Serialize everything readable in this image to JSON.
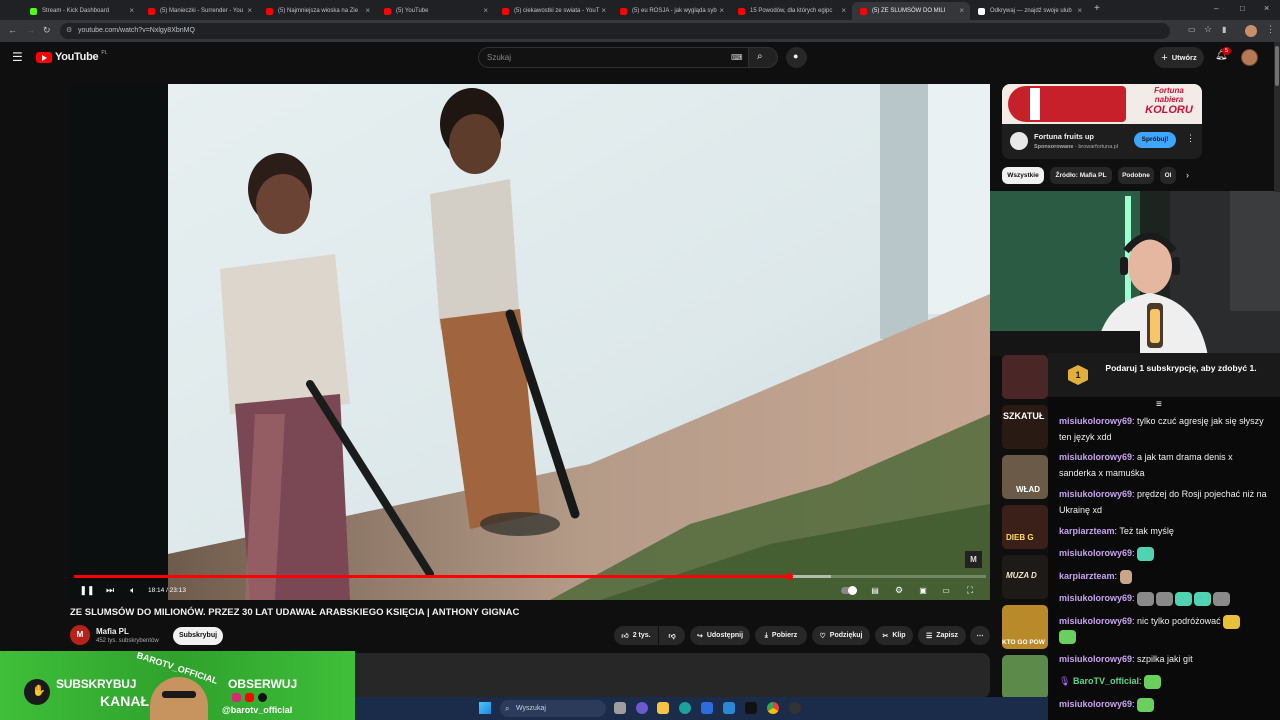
{
  "browser": {
    "tabs": [
      {
        "title": "Stream - Kick Dashboard",
        "icon": "kick-icon",
        "color": "#53fc18"
      },
      {
        "title": "(5) Manieczki - Surrender - You",
        "icon": "youtube-icon",
        "color": "#ff0000"
      },
      {
        "title": "(5) Najmniejsza wioska na Zie",
        "icon": "youtube-icon",
        "color": "#ff0000"
      },
      {
        "title": "(5) YouTube",
        "icon": "youtube-icon",
        "color": "#ff0000"
      },
      {
        "title": "(5) ciekawostki ze swiata - YouT",
        "icon": "youtube-icon",
        "color": "#ff0000"
      },
      {
        "title": "(5) eu ROSJA - jak wygląda syb",
        "icon": "youtube-icon",
        "color": "#ff0000"
      },
      {
        "title": "15 Powodów, dla których egipc",
        "icon": "youtube-icon",
        "color": "#ff0000"
      },
      {
        "title": "(5) ZE SLUMSÓW DO MILI",
        "icon": "youtube-icon",
        "color": "#ff0000",
        "active": true
      },
      {
        "title": "Odkrywaj — znajdź swoje ulub",
        "icon": "tiktok-icon",
        "color": "#ffffff"
      }
    ],
    "url": "youtube.com/watch?v=Nxlgy8XbnMQ"
  },
  "youtube": {
    "logo_text": "YouTube",
    "region": "PL",
    "search_placeholder": "Szukaj",
    "create_label": "Utwórz",
    "notif_count": "5"
  },
  "player": {
    "time_current": "18:14",
    "time_total": "23:13",
    "time_display": "18:14 / 23:13",
    "progress_fraction": 0.785,
    "buffered_fraction": 0.83,
    "watermark": "M"
  },
  "video": {
    "title": "ZE SLUMSÓW DO MILIONÓW. PRZEZ 30 LAT UDAWAŁ ARABSKIEGO KSIĘCIA | ANTHONY GIGNAC",
    "channel": "Mafia PL",
    "channel_initial": "M",
    "subscribers": "452 tys. subskrybentów",
    "subscribe_label": "Subskrybuj",
    "likes": "2 tys.",
    "actions": [
      "Udostępnij",
      "Pobierz",
      "Podziękuj",
      "Klip",
      "Zapisz"
    ]
  },
  "ad": {
    "banner_line1": "Fortuna",
    "banner_line2": "nabiera",
    "banner_line3": "KOLORU",
    "title": "Fortuna fruits up",
    "sponsored": "Sponsorowane",
    "domain": "browarfortuna.pl",
    "cta": "Spróbuj!"
  },
  "chips": [
    "Wszystkie",
    "Źródło: Mafia PL",
    "Podobne",
    "Ol"
  ],
  "thumb_texts": [
    "",
    "SZKATUŁ",
    "WŁAD",
    "DIEB G",
    "MUZA D",
    "KTO GO POW",
    ""
  ],
  "chat": {
    "subgoal_count": "1",
    "subgoal_text": "Podaruj 1 subskrypcję, aby zdobyć 1.",
    "messages": [
      {
        "user": "misiukolorowy69",
        "text": "tylko czuć agresję jak się słyszy ten język xdd"
      },
      {
        "user": "misiukolorowy69",
        "text": "a jak tam drama denis x sanderka x mamuśka"
      },
      {
        "user": "misiukolorowy69",
        "text": "prędzej do Rosji pojechać niż na Ukrainę xd"
      },
      {
        "user": "karpiarzteam",
        "text": "Też tak myślę"
      },
      {
        "user": "misiukolorowy69",
        "text": ""
      },
      {
        "user": "karpiarzteam",
        "text": ""
      },
      {
        "user": "misiukolorowy69",
        "text": ""
      },
      {
        "user": "misiukolorowy69",
        "text": "nic tylko podróżować"
      },
      {
        "user": "misiukolorowy69",
        "text": "szpilka jaki git"
      },
      {
        "user": "BaroTV_official",
        "text": ""
      },
      {
        "user": "misiukolorowy69",
        "text": ""
      }
    ]
  },
  "overlay": {
    "left_line1": "SUBSKRYBUJ",
    "left_line2": "KANAŁ",
    "arc_text": "BAROTV_OFFICIAL",
    "right_line1": "OBSERWUJ",
    "handle": "@barotv_official"
  },
  "taskbar": {
    "search_label": "Wyszukaj"
  }
}
